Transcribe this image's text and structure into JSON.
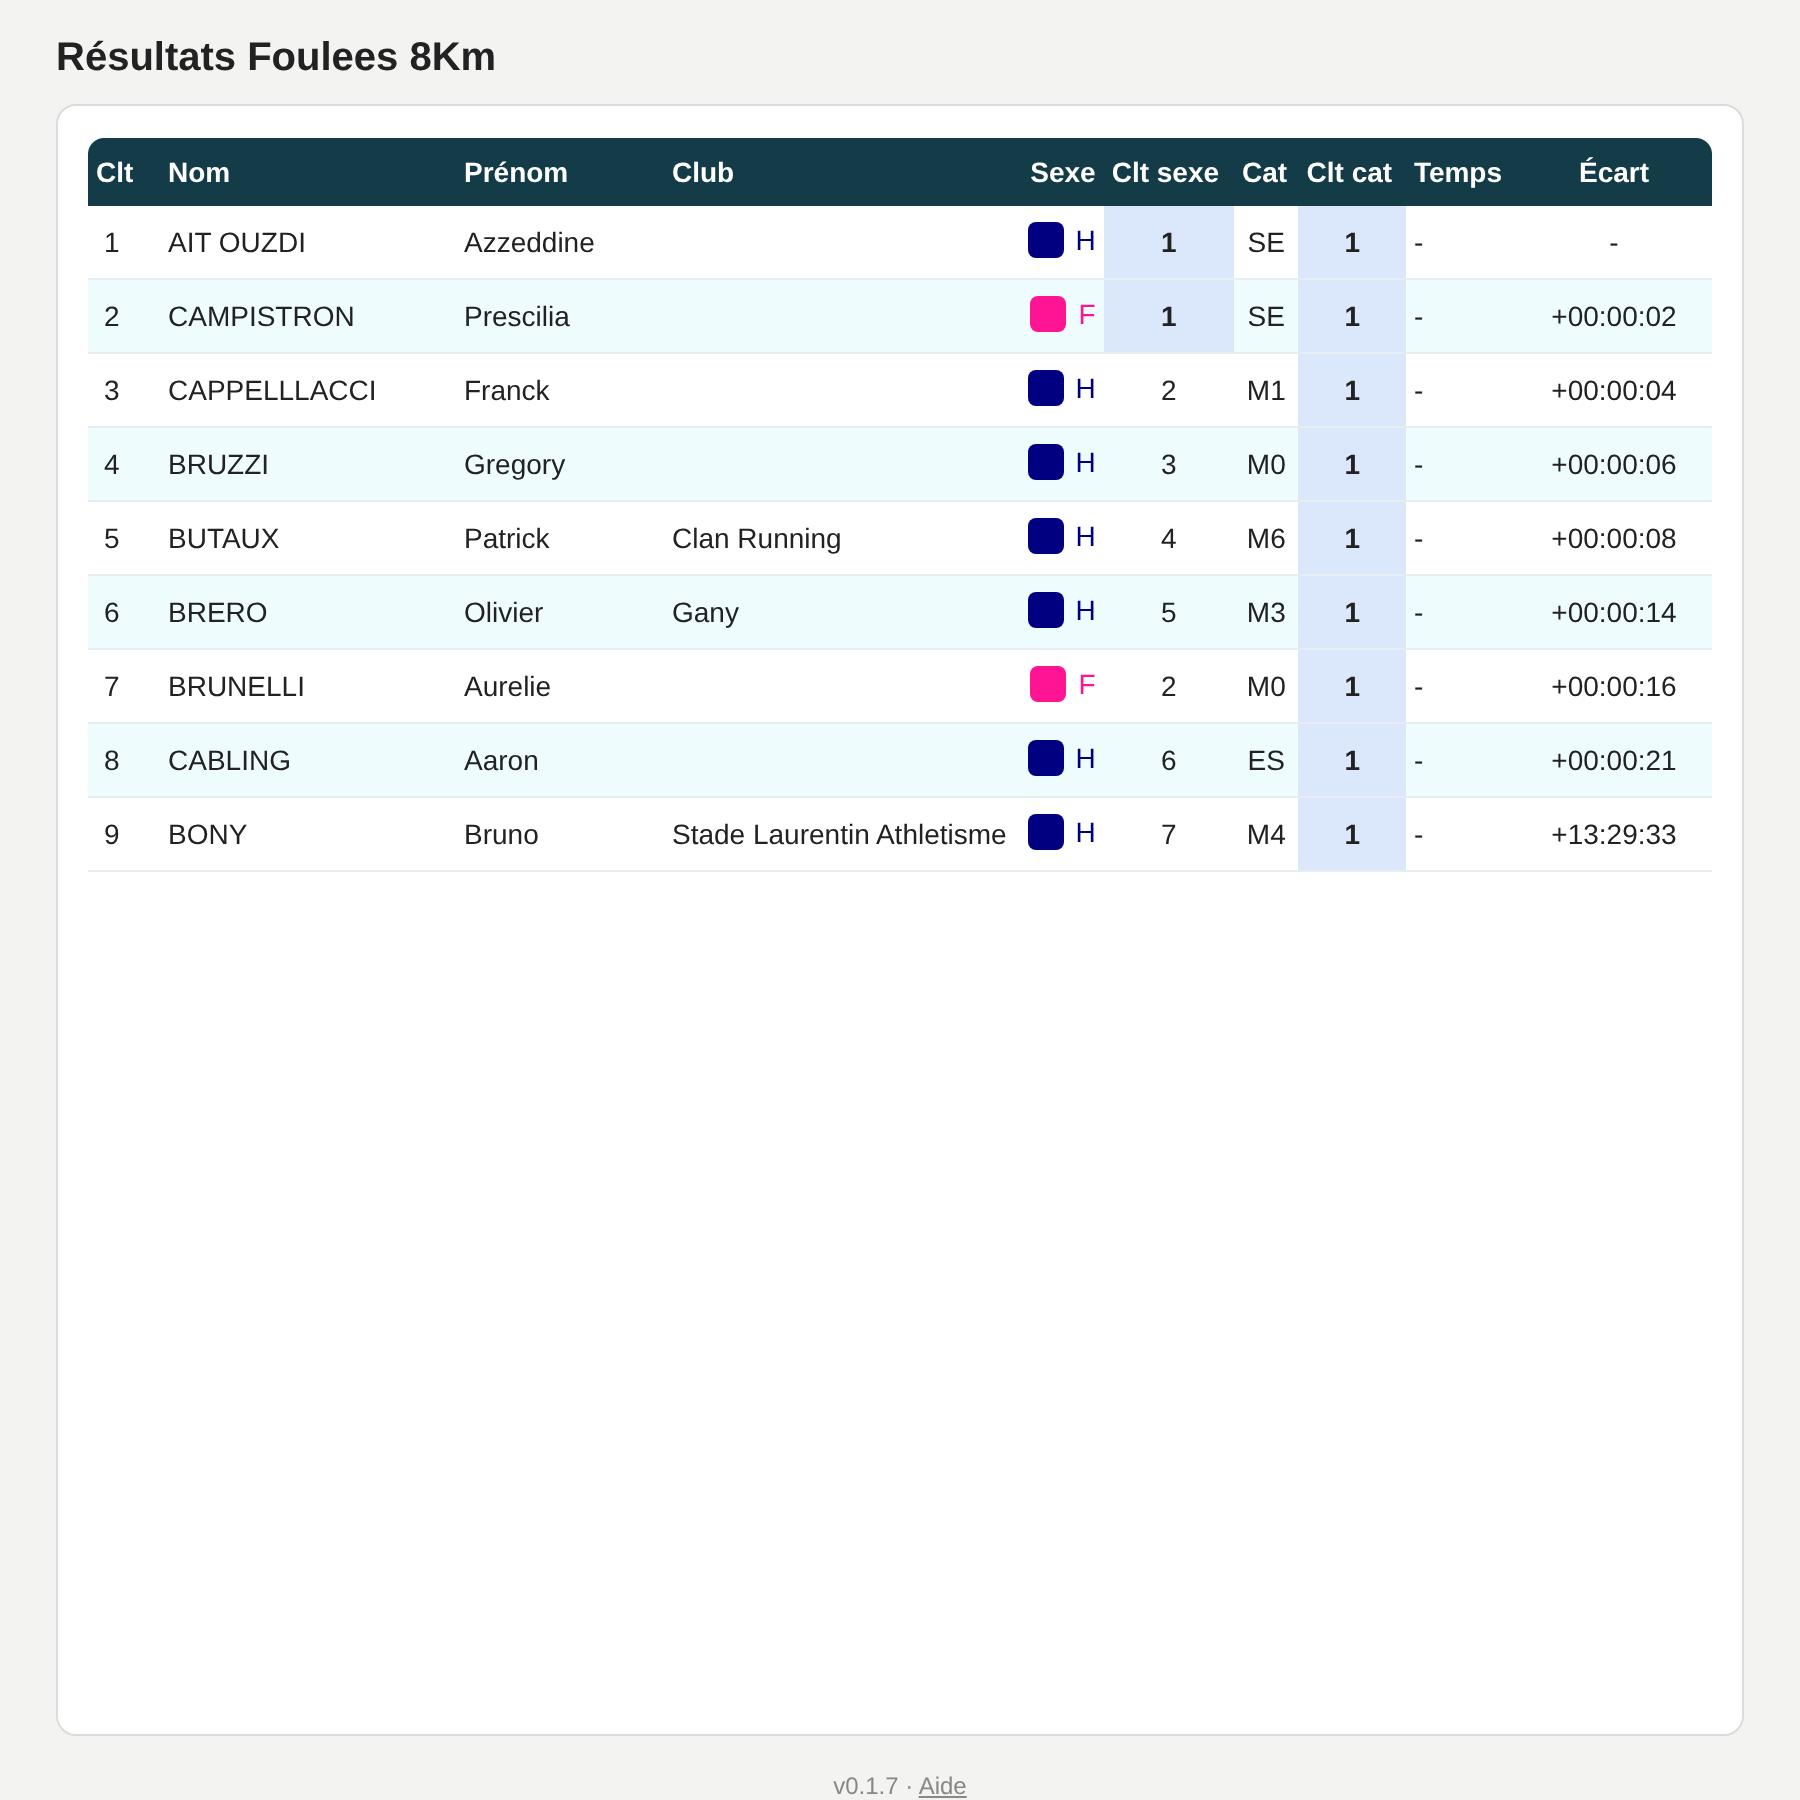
{
  "title": "Résultats Foulees 8Km",
  "table": {
    "columns": [
      "Clt",
      "Nom",
      "Prénom",
      "Club",
      "Sexe",
      "Clt sexe",
      "Cat",
      "Clt cat",
      "Temps",
      "Écart"
    ],
    "rows": [
      {
        "rank": "1",
        "last_name": "AIT OUZDI",
        "first_name": "Azzeddine",
        "club": "",
        "sex": "H",
        "color": "#000080",
        "sex_rank": {
          "value": "1",
          "highlighted": true
        },
        "category": "SE",
        "category_rank": {
          "value": "1",
          "highlighted": true
        },
        "time": "-",
        "gap": "-"
      },
      {
        "rank": "2",
        "last_name": "CAMPISTRON",
        "first_name": "Prescilia",
        "club": "",
        "sex": "F",
        "color": "#ff1493",
        "sex_rank": {
          "value": "1",
          "highlighted": true
        },
        "category": "SE",
        "category_rank": {
          "value": "1",
          "highlighted": true
        },
        "time": "-",
        "gap": "+00:00:02"
      },
      {
        "rank": "3",
        "last_name": "CAPPELLLACCI",
        "first_name": "Franck",
        "club": "",
        "sex": "H",
        "color": "#000080",
        "sex_rank": {
          "value": "2",
          "highlighted": false
        },
        "category": "M1",
        "category_rank": {
          "value": "1",
          "highlighted": true
        },
        "time": "-",
        "gap": "+00:00:04"
      },
      {
        "rank": "4",
        "last_name": "BRUZZI",
        "first_name": "Gregory",
        "club": "",
        "sex": "H",
        "color": "#000080",
        "sex_rank": {
          "value": "3",
          "highlighted": false
        },
        "category": "M0",
        "category_rank": {
          "value": "1",
          "highlighted": true
        },
        "time": "-",
        "gap": "+00:00:06"
      },
      {
        "rank": "5",
        "last_name": "BUTAUX",
        "first_name": "Patrick",
        "club": "Clan Running",
        "sex": "H",
        "color": "#000080",
        "sex_rank": {
          "value": "4",
          "highlighted": false
        },
        "category": "M6",
        "category_rank": {
          "value": "1",
          "highlighted": true
        },
        "time": "-",
        "gap": "+00:00:08"
      },
      {
        "rank": "6",
        "last_name": "BRERO",
        "first_name": "Olivier",
        "club": "Gany",
        "sex": "H",
        "color": "#000080",
        "sex_rank": {
          "value": "5",
          "highlighted": false
        },
        "category": "M3",
        "category_rank": {
          "value": "1",
          "highlighted": true
        },
        "time": "-",
        "gap": "+00:00:14"
      },
      {
        "rank": "7",
        "last_name": "BRUNELLI",
        "first_name": "Aurelie",
        "club": "",
        "sex": "F",
        "color": "#ff1493",
        "sex_rank": {
          "value": "2",
          "highlighted": false
        },
        "category": "M0",
        "category_rank": {
          "value": "1",
          "highlighted": true
        },
        "time": "-",
        "gap": "+00:00:16"
      },
      {
        "rank": "8",
        "last_name": "CABLING",
        "first_name": "Aaron",
        "club": "",
        "sex": "H",
        "color": "#000080",
        "sex_rank": {
          "value": "6",
          "highlighted": false
        },
        "category": "ES",
        "category_rank": {
          "value": "1",
          "highlighted": true
        },
        "time": "-",
        "gap": "+00:00:21"
      },
      {
        "rank": "9",
        "last_name": "BONY",
        "first_name": "Bruno",
        "club": "Stade Laurentin Athletisme",
        "sex": "H",
        "color": "#000080",
        "sex_rank": {
          "value": "7",
          "highlighted": false
        },
        "category": "M4",
        "category_rank": {
          "value": "1",
          "highlighted": true
        },
        "time": "-",
        "gap": "+13:29:33"
      }
    ]
  },
  "footer": {
    "version": "v0.1.7 ·",
    "link": "Aide"
  }
}
